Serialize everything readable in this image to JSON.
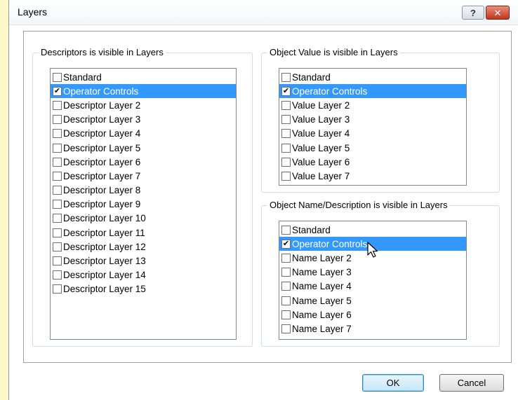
{
  "dialog": {
    "title": "Layers",
    "help_label": "?",
    "close_label": "✕"
  },
  "descriptors": {
    "title": "Descriptors is visible in Layers",
    "items": [
      {
        "label": "Standard",
        "checked": false,
        "selected": false
      },
      {
        "label": "Operator Controls",
        "checked": true,
        "selected": true
      },
      {
        "label": "Descriptor Layer 2",
        "checked": false,
        "selected": false
      },
      {
        "label": "Descriptor Layer 3",
        "checked": false,
        "selected": false
      },
      {
        "label": "Descriptor Layer 4",
        "checked": false,
        "selected": false
      },
      {
        "label": "Descriptor Layer 5",
        "checked": false,
        "selected": false
      },
      {
        "label": "Descriptor Layer 6",
        "checked": false,
        "selected": false
      },
      {
        "label": "Descriptor Layer 7",
        "checked": false,
        "selected": false
      },
      {
        "label": "Descriptor Layer 8",
        "checked": false,
        "selected": false
      },
      {
        "label": "Descriptor Layer 9",
        "checked": false,
        "selected": false
      },
      {
        "label": "Descriptor Layer 10",
        "checked": false,
        "selected": false
      },
      {
        "label": "Descriptor Layer 11",
        "checked": false,
        "selected": false
      },
      {
        "label": "Descriptor Layer 12",
        "checked": false,
        "selected": false
      },
      {
        "label": "Descriptor Layer 13",
        "checked": false,
        "selected": false
      },
      {
        "label": "Descriptor Layer 14",
        "checked": false,
        "selected": false
      },
      {
        "label": "Descriptor Layer 15",
        "checked": false,
        "selected": false
      }
    ]
  },
  "values": {
    "title": "Object Value is visible in Layers",
    "items": [
      {
        "label": "Standard",
        "checked": false,
        "selected": false
      },
      {
        "label": "Operator Controls",
        "checked": true,
        "selected": true
      },
      {
        "label": "Value Layer 2",
        "checked": false,
        "selected": false
      },
      {
        "label": "Value Layer 3",
        "checked": false,
        "selected": false
      },
      {
        "label": "Value Layer 4",
        "checked": false,
        "selected": false
      },
      {
        "label": "Value Layer 5",
        "checked": false,
        "selected": false
      },
      {
        "label": "Value Layer 6",
        "checked": false,
        "selected": false
      },
      {
        "label": "Value Layer 7",
        "checked": false,
        "selected": false
      }
    ]
  },
  "names": {
    "title": "Object Name/Description is visible in Layers",
    "items": [
      {
        "label": "Standard",
        "checked": false,
        "selected": false
      },
      {
        "label": "Operator Controls",
        "checked": true,
        "selected": true
      },
      {
        "label": "Name Layer 2",
        "checked": false,
        "selected": false
      },
      {
        "label": "Name Layer 3",
        "checked": false,
        "selected": false
      },
      {
        "label": "Name Layer 4",
        "checked": false,
        "selected": false
      },
      {
        "label": "Name Layer 5",
        "checked": false,
        "selected": false
      },
      {
        "label": "Name Layer 6",
        "checked": false,
        "selected": false
      },
      {
        "label": "Name Layer 7",
        "checked": false,
        "selected": false
      }
    ]
  },
  "buttons": {
    "ok_label": "OK",
    "cancel_label": "Cancel"
  },
  "colors": {
    "selection": "#3399ff",
    "close_button": "#c2361c"
  },
  "icons": {
    "help": "help-icon",
    "close": "close-icon",
    "check": "checkmark-icon",
    "cursor": "mouse-pointer-icon"
  }
}
